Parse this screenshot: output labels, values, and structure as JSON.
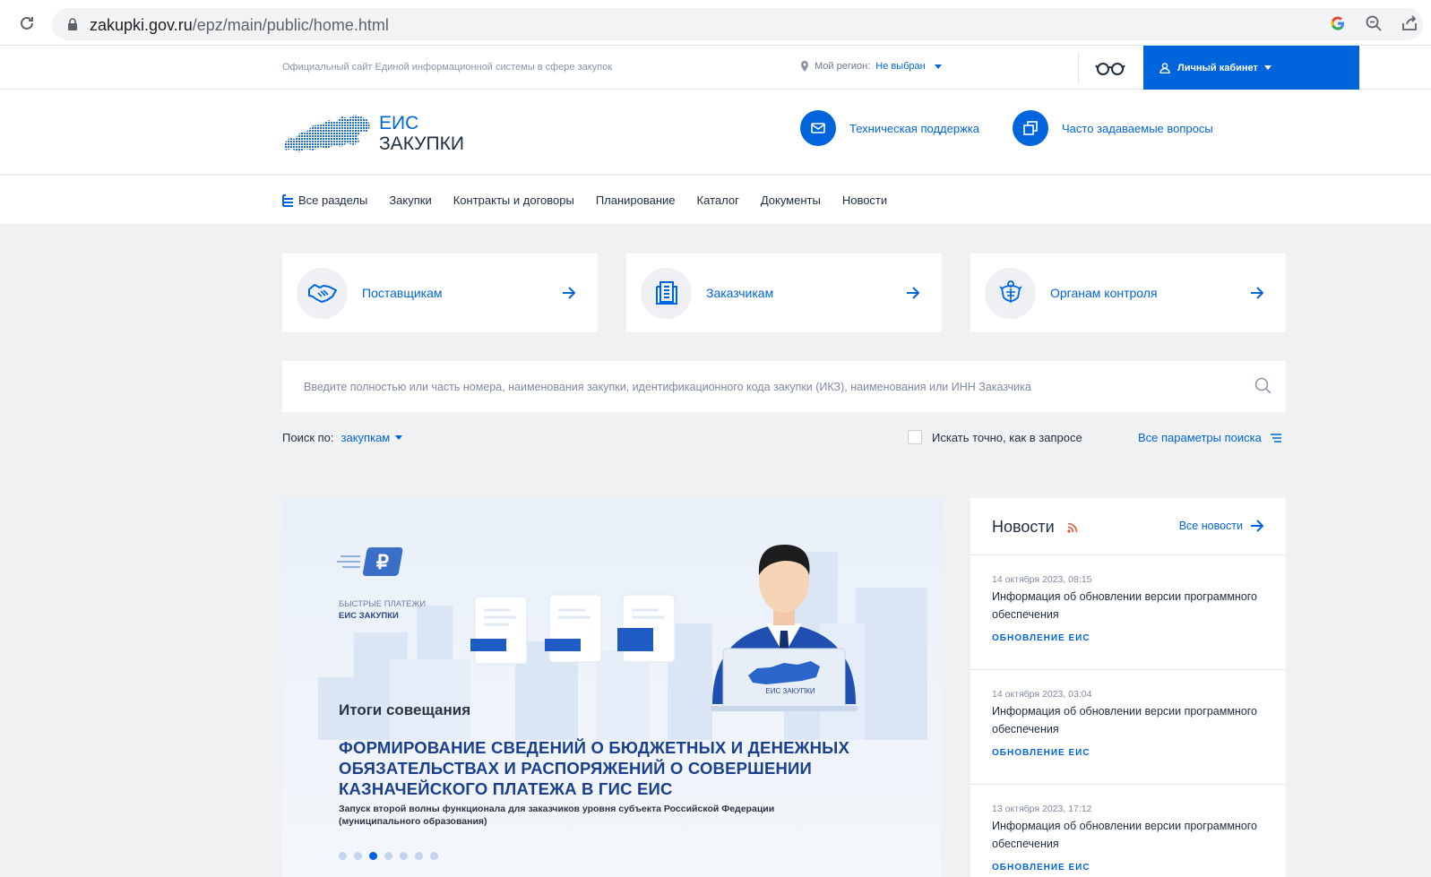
{
  "browser": {
    "url_host": "zakupki.gov.ru",
    "url_path": "/epz/main/public/home.html"
  },
  "topbar": {
    "tagline": "Официальный сайт Единой информационной системы в сфере закупок",
    "region_label": "Мой регион:",
    "region_value": "Не выбран",
    "cabinet_label": "Личный кабинет"
  },
  "header": {
    "logo_line1": "ЕИС",
    "logo_line2": "ЗАКУПКИ",
    "support_label": "Техническая поддержка",
    "faq_label": "Часто задаваемые вопросы"
  },
  "nav": {
    "items": [
      "Все разделы",
      "Закупки",
      "Контракты и договоры",
      "Планирование",
      "Каталог",
      "Документы",
      "Новости"
    ]
  },
  "roles": [
    {
      "label": "Поставщикам",
      "icon": "handshake-icon"
    },
    {
      "label": "Заказчикам",
      "icon": "document-building-icon"
    },
    {
      "label": "Органам контроля",
      "icon": "emblem-icon"
    }
  ],
  "search": {
    "placeholder": "Введите полностью или часть номера, наименования закупки, идентификационного кода закупки (ИКЗ), наименования или ИНН Заказчика",
    "by_label": "Поиск по:",
    "by_value": "закупкам",
    "exact_label": "Искать точно, как в запросе",
    "all_params_label": "Все параметры поиска"
  },
  "banner": {
    "brand_line1": "БЫСТРЫЕ ПЛАТЕЖИ",
    "brand_line2": "ЕИС ЗАКУПКИ",
    "subtitle": "Итоги совещания",
    "headline_1": "Формирование сведений о бюджетных и денежных",
    "headline_2": "обязательствах и распоряжений о совершении",
    "headline_3": "казначейского платежа в ГИС ЕИС",
    "desc_1": "Запуск второй волны функционала для заказчиков уровня субъекта Российской Федерации",
    "desc_2": "(муниципального образования)",
    "laptop_label": "ЕИС ЗАКУПКИ",
    "slides_total": 7,
    "active_slide": 3
  },
  "news": {
    "title": "Новости",
    "all_label": "Все новости",
    "items": [
      {
        "date": "14 октября 2023, 08:15",
        "text": "Информация об обновлении версии программного обеспечения",
        "tag": "ОБНОВЛЕНИЕ ЕИС"
      },
      {
        "date": "14 октября 2023, 03:04",
        "text": "Информация об обновлении версии программного обеспечения",
        "tag": "ОБНОВЛЕНИЕ ЕИС"
      },
      {
        "date": "13 октября 2023, 17:12",
        "text": "Информация об обновлении версии программного обеспечения",
        "tag": "ОБНОВЛЕНИЕ ЕИС"
      }
    ]
  },
  "colors": {
    "accent": "#0065dd",
    "background": "#f0f1f3",
    "rss": "#e8553a"
  }
}
